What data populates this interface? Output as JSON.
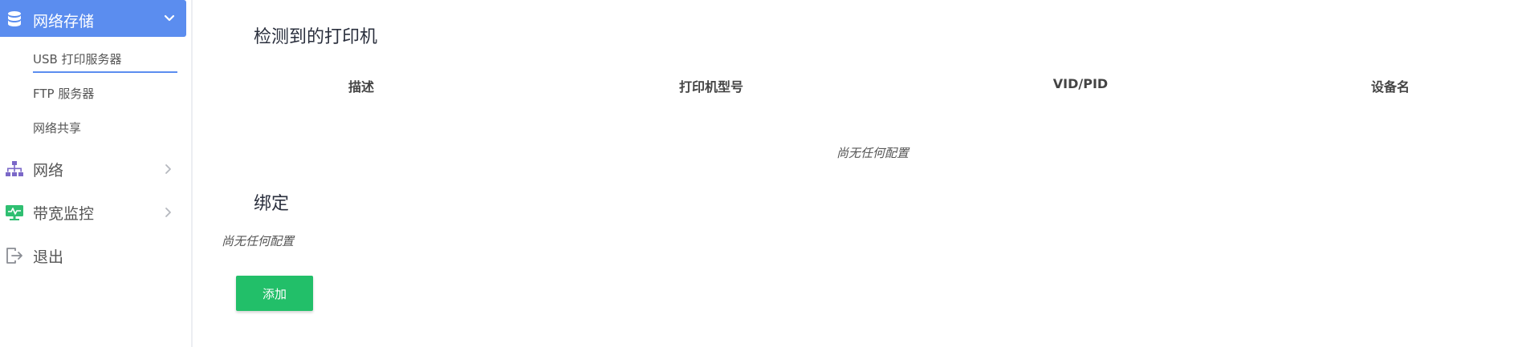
{
  "sidebar": {
    "active_group": {
      "label": "网络存储",
      "icon": "database-icon"
    },
    "submenu": [
      {
        "label": "USB 打印服务器",
        "active": true
      },
      {
        "label": "FTP 服务器",
        "active": false
      },
      {
        "label": "网络共享",
        "active": false
      }
    ],
    "items": [
      {
        "label": "网络",
        "icon": "network-topology-icon"
      },
      {
        "label": "带宽监控",
        "icon": "monitor-pulse-icon"
      },
      {
        "label": "退出",
        "icon": "logout-icon"
      }
    ]
  },
  "main": {
    "printers_title": "检测到的打印机",
    "table": {
      "columns": [
        "描述",
        "打印机型号",
        "VID/PID",
        "设备名"
      ],
      "empty_text": "尚无任何配置"
    },
    "binding_title": "绑定",
    "binding_empty_text": "尚无任何配置",
    "add_label": "添加"
  },
  "colors": {
    "accent": "#5b8def",
    "add_button": "#22bf69",
    "network_icon": "#7b68c8",
    "monitor_icon": "#2fbf71"
  }
}
